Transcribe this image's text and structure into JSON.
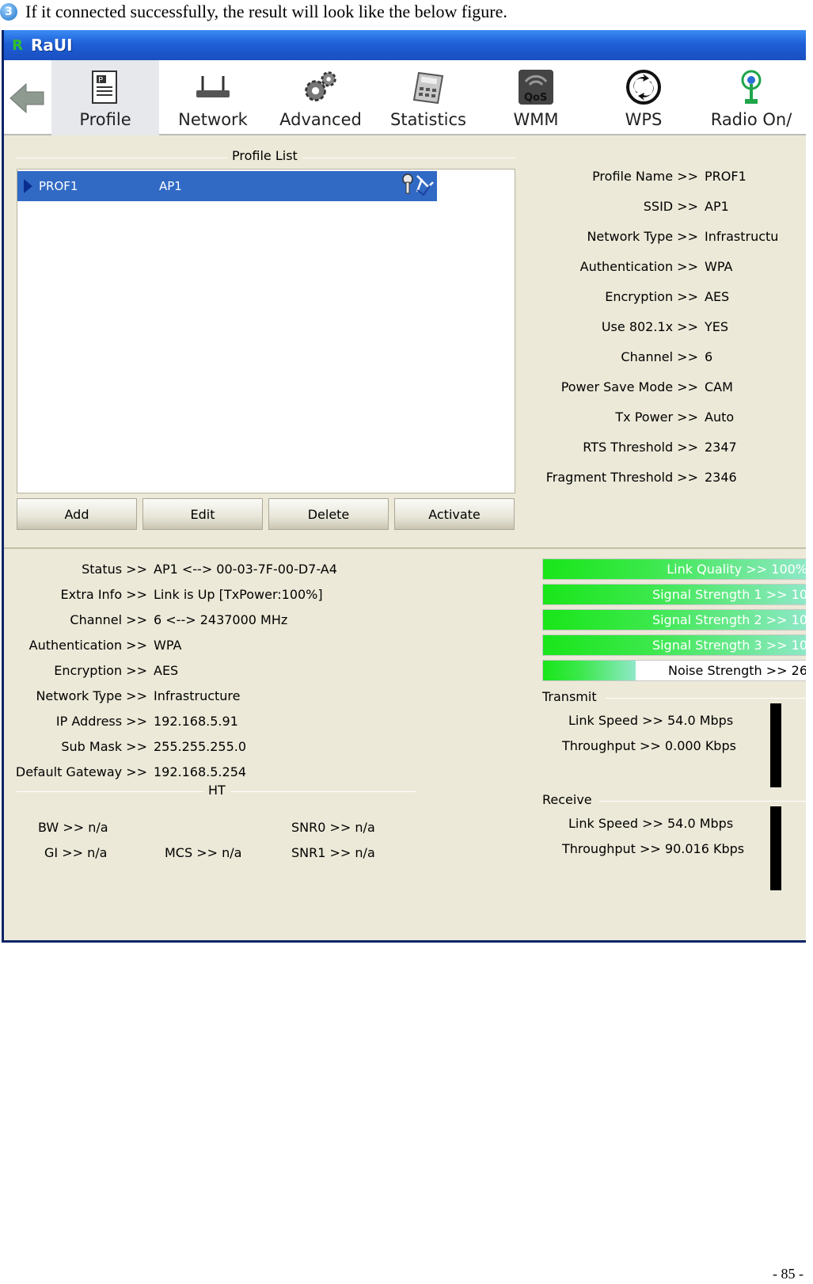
{
  "doc": {
    "bullet": "3",
    "intro": "If it connected successfully, the result will look like the below figure.",
    "page_number": "- 85 -"
  },
  "window": {
    "title": "RaUI"
  },
  "toolbar": {
    "items": [
      {
        "label": "Profile",
        "icon": "profile-icon",
        "active": true
      },
      {
        "label": "Network",
        "icon": "router-icon"
      },
      {
        "label": "Advanced",
        "icon": "gears-icon"
      },
      {
        "label": "Statistics",
        "icon": "calculator-icon"
      },
      {
        "label": "WMM",
        "icon": "qos-icon"
      },
      {
        "label": "WPS",
        "icon": "wps-icon"
      },
      {
        "label": "Radio On/",
        "icon": "antenna-icon"
      }
    ]
  },
  "profile_list": {
    "title": "Profile List",
    "rows": [
      {
        "name": "PROF1",
        "ssid": "AP1"
      }
    ],
    "buttons": [
      "Add",
      "Edit",
      "Delete",
      "Activate"
    ]
  },
  "profile_details": [
    {
      "label": "Profile Name >>",
      "value": "PROF1"
    },
    {
      "label": "SSID >>",
      "value": "AP1"
    },
    {
      "label": "Network Type >>",
      "value": "Infrastructu"
    },
    {
      "label": "Authentication >>",
      "value": "WPA"
    },
    {
      "label": "Encryption >>",
      "value": "AES"
    },
    {
      "label": "Use 802.1x >>",
      "value": "YES"
    },
    {
      "label": "Channel >>",
      "value": "6"
    },
    {
      "label": "Power Save Mode >>",
      "value": "CAM"
    },
    {
      "label": "Tx Power >>",
      "value": "Auto"
    },
    {
      "label": "RTS Threshold >>",
      "value": "2347"
    },
    {
      "label": "Fragment Threshold >>",
      "value": "2346"
    }
  ],
  "status": [
    {
      "label": "Status >>",
      "value": "AP1 <--> 00-03-7F-00-D7-A4"
    },
    {
      "label": "Extra Info >>",
      "value": "Link is Up  [TxPower:100%]"
    },
    {
      "label": "Channel >>",
      "value": "6 <--> 2437000 MHz"
    },
    {
      "label": "Authentication >>",
      "value": "WPA"
    },
    {
      "label": "Encryption >>",
      "value": "AES"
    },
    {
      "label": "Network Type >>",
      "value": "Infrastructure"
    },
    {
      "label": "IP Address >>",
      "value": "192.168.5.91"
    },
    {
      "label": "Sub Mask >>",
      "value": "255.255.255.0"
    },
    {
      "label": "Default Gateway >>",
      "value": "192.168.5.254"
    }
  ],
  "ht": {
    "title": "HT",
    "bw": "BW >> n/a",
    "gi": "GI >> n/a",
    "mcs": "MCS >> n/a",
    "snr0": "SNR0 >> n/a",
    "snr1": "SNR1 >> n/a"
  },
  "signal": [
    {
      "label": "Link Quality >> 100%",
      "fraction": 1.0
    },
    {
      "label": "Signal Strength 1 >> 10",
      "fraction": 1.0
    },
    {
      "label": "Signal Strength 2 >> 10",
      "fraction": 1.0
    },
    {
      "label": "Signal Strength 3 >> 10",
      "fraction": 1.0
    },
    {
      "label": "Noise Strength >> 26",
      "fraction": 0.35
    }
  ],
  "transmit": {
    "title": "Transmit",
    "link_speed": "Link Speed >>  54.0 Mbps",
    "throughput": "Throughput >>  0.000 Kbps"
  },
  "receive": {
    "title": "Receive",
    "link_speed": "Link Speed >>  54.0 Mbps",
    "throughput": "Throughput >>  90.016 Kbps"
  }
}
